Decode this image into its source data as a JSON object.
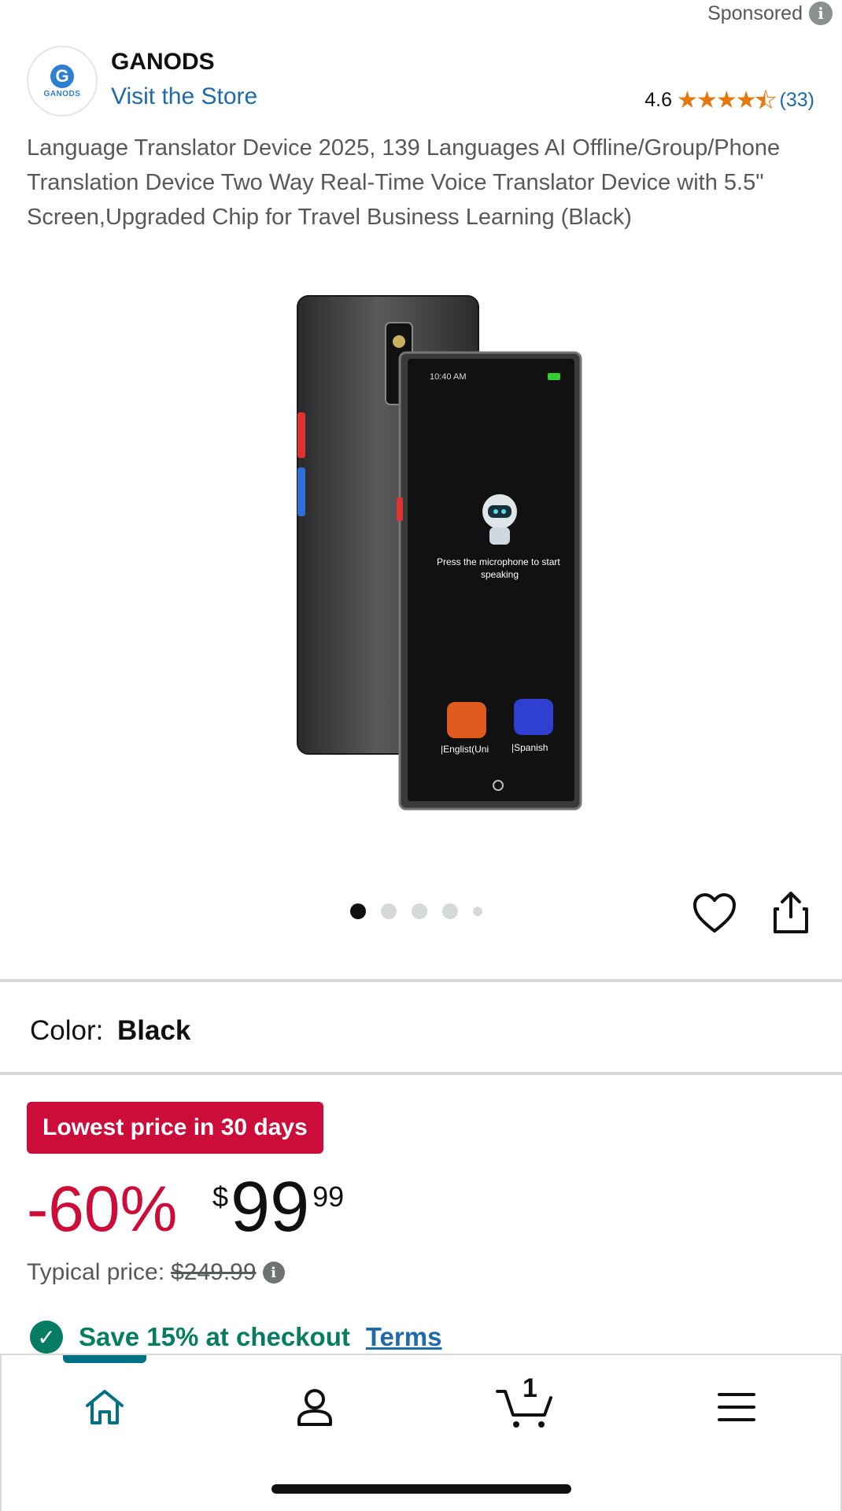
{
  "sponsored": {
    "label": "Sponsored",
    "info_icon": "info-icon"
  },
  "store": {
    "brand": "GANODS",
    "logo_letter": "G",
    "logo_text": "GANODS",
    "visit_link": "Visit the Store",
    "rating": "4.6",
    "stars": 4.5,
    "review_count": "(33)"
  },
  "product": {
    "title": "Language Translator Device 2025, 139 Languages AI Offline/Group/Phone Translation Device Two Way Real-Time Voice Translator Device with 5.5\" Screen,Upgraded Chip for Travel Business Learning (Black)",
    "image": {
      "screen_time": "10:40 AM",
      "screen_message": "Press the microphone to start speaking",
      "lang_left": "|Englist(Uni",
      "lang_right": "|Spanish"
    },
    "carousel": {
      "count": 5,
      "active_index": 0
    }
  },
  "color": {
    "label": "Color:",
    "value": "Black"
  },
  "pricing": {
    "deal_badge": "Lowest price in 30 days",
    "discount": "-60%",
    "currency": "$",
    "price_whole": "99",
    "price_fraction": "99",
    "typical_label": "Typical price:",
    "typical_price": "$249.99"
  },
  "coupon": {
    "text": "Save 15% at checkout",
    "terms": "Terms"
  },
  "bottom_nav": {
    "items": [
      "home-icon",
      "account-icon",
      "cart-icon",
      "menu-icon"
    ],
    "cart_count": "1",
    "active": "home-icon"
  },
  "colors": {
    "link": "#1f6aa8",
    "deal_red": "#cc0c39",
    "success_green": "#067d62",
    "star_orange": "#e47911",
    "nav_accent": "#007185"
  }
}
